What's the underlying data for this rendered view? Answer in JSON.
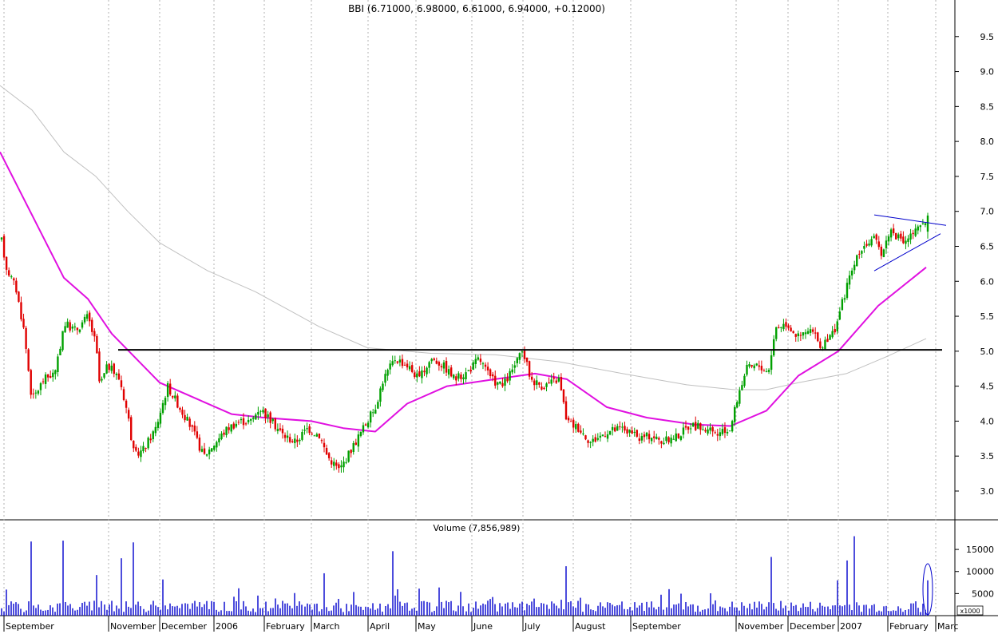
{
  "colors": {
    "background": "#ffffff",
    "up_candle": "#00a000",
    "down_candle": "#e00000",
    "ma_short": "#e010e0",
    "ma_long": "#c0c0c0",
    "volume": "#0000cc",
    "support_line": "#000000",
    "trendline": "#0000cc",
    "grid": "#b0b0b0"
  },
  "chart_data": [
    {
      "type": "candlestick",
      "title": "BBI (6.71000, 6.98000, 6.61000, 6.94000, +0.12000)",
      "ylim": [
        2.6,
        10.0
      ],
      "y_ticks": [
        3.0,
        3.5,
        4.0,
        4.5,
        5.0,
        5.5,
        6.0,
        6.5,
        7.0,
        7.5,
        8.0,
        8.5,
        9.0,
        9.5
      ],
      "x_month_labels": [
        "September",
        "November",
        "December",
        "2006",
        "February",
        "March",
        "April",
        "May",
        "June",
        "July",
        "August",
        "September",
        "November",
        "December",
        "2007",
        "February",
        "Marc"
      ],
      "grid": "vertical dotted at month boundaries",
      "last_ohlc": {
        "open": 6.71,
        "high": 6.98,
        "low": 6.61,
        "close": 6.94,
        "change": 0.12
      },
      "price_path": [
        [
          0,
          6.7
        ],
        [
          8,
          6.2
        ],
        [
          20,
          5.9
        ],
        [
          30,
          5.3
        ],
        [
          40,
          4.3
        ],
        [
          55,
          4.6
        ],
        [
          70,
          4.7
        ],
        [
          80,
          5.4
        ],
        [
          95,
          5.3
        ],
        [
          110,
          5.5
        ],
        [
          120,
          5.1
        ],
        [
          125,
          4.5
        ],
        [
          135,
          4.8
        ],
        [
          150,
          4.6
        ],
        [
          160,
          4.1
        ],
        [
          168,
          3.5
        ],
        [
          180,
          3.6
        ],
        [
          195,
          3.9
        ],
        [
          210,
          4.5
        ],
        [
          225,
          4.2
        ],
        [
          240,
          3.9
        ],
        [
          255,
          3.5
        ],
        [
          270,
          3.7
        ],
        [
          285,
          3.9
        ],
        [
          300,
          4.0
        ],
        [
          315,
          4.0
        ],
        [
          325,
          4.2
        ],
        [
          340,
          4.0
        ],
        [
          355,
          3.8
        ],
        [
          370,
          3.7
        ],
        [
          385,
          3.9
        ],
        [
          400,
          3.8
        ],
        [
          410,
          3.5
        ],
        [
          425,
          3.3
        ],
        [
          440,
          3.6
        ],
        [
          455,
          3.9
        ],
        [
          470,
          4.2
        ],
        [
          480,
          4.6
        ],
        [
          495,
          4.9
        ],
        [
          510,
          4.8
        ],
        [
          525,
          4.6
        ],
        [
          540,
          4.9
        ],
        [
          555,
          4.8
        ],
        [
          570,
          4.6
        ],
        [
          585,
          4.7
        ],
        [
          600,
          4.9
        ],
        [
          615,
          4.6
        ],
        [
          630,
          4.5
        ],
        [
          645,
          4.8
        ],
        [
          655,
          5.0
        ],
        [
          665,
          4.6
        ],
        [
          680,
          4.5
        ],
        [
          700,
          4.6
        ],
        [
          710,
          4.0
        ],
        [
          725,
          3.9
        ],
        [
          740,
          3.7
        ],
        [
          760,
          3.85
        ],
        [
          780,
          3.9
        ],
        [
          800,
          3.75
        ],
        [
          815,
          3.8
        ],
        [
          830,
          3.7
        ],
        [
          850,
          3.8
        ],
        [
          865,
          3.95
        ],
        [
          880,
          3.9
        ],
        [
          900,
          3.8
        ],
        [
          915,
          3.9
        ],
        [
          925,
          4.4
        ],
        [
          935,
          4.75
        ],
        [
          950,
          4.8
        ],
        [
          962,
          4.7
        ],
        [
          972,
          5.35
        ],
        [
          985,
          5.4
        ],
        [
          1000,
          5.2
        ],
        [
          1015,
          5.3
        ],
        [
          1030,
          5.05
        ],
        [
          1045,
          5.3
        ],
        [
          1055,
          5.7
        ],
        [
          1065,
          6.1
        ],
        [
          1080,
          6.5
        ],
        [
          1095,
          6.6
        ],
        [
          1105,
          6.4
        ],
        [
          1115,
          6.75
        ],
        [
          1130,
          6.55
        ],
        [
          1145,
          6.7
        ],
        [
          1158,
          6.82
        ],
        [
          1162,
          6.94
        ]
      ],
      "ma_short_path": [
        [
          0,
          7.85
        ],
        [
          40,
          6.95
        ],
        [
          80,
          6.05
        ],
        [
          110,
          5.75
        ],
        [
          140,
          5.25
        ],
        [
          200,
          4.55
        ],
        [
          250,
          4.3
        ],
        [
          290,
          4.1
        ],
        [
          330,
          4.05
        ],
        [
          390,
          4.0
        ],
        [
          430,
          3.9
        ],
        [
          470,
          3.85
        ],
        [
          510,
          4.25
        ],
        [
          560,
          4.5
        ],
        [
          620,
          4.6
        ],
        [
          670,
          4.68
        ],
        [
          710,
          4.6
        ],
        [
          760,
          4.2
        ],
        [
          810,
          4.05
        ],
        [
          870,
          3.95
        ],
        [
          915,
          3.93
        ],
        [
          960,
          4.15
        ],
        [
          1000,
          4.65
        ],
        [
          1050,
          5.0
        ],
        [
          1100,
          5.65
        ],
        [
          1160,
          6.2
        ]
      ],
      "ma_long_path": [
        [
          0,
          8.8
        ],
        [
          40,
          8.45
        ],
        [
          80,
          7.85
        ],
        [
          120,
          7.5
        ],
        [
          160,
          7.0
        ],
        [
          200,
          6.55
        ],
        [
          260,
          6.15
        ],
        [
          320,
          5.85
        ],
        [
          400,
          5.35
        ],
        [
          460,
          5.05
        ],
        [
          540,
          4.97
        ],
        [
          620,
          4.95
        ],
        [
          700,
          4.85
        ],
        [
          780,
          4.68
        ],
        [
          860,
          4.52
        ],
        [
          920,
          4.45
        ],
        [
          960,
          4.45
        ],
        [
          1000,
          4.55
        ],
        [
          1060,
          4.68
        ],
        [
          1110,
          4.92
        ],
        [
          1160,
          5.18
        ]
      ],
      "support_level": 5.02,
      "triangle_upper": [
        [
          1095,
          6.95
        ],
        [
          1185,
          6.8
        ]
      ],
      "triangle_lower": [
        [
          1095,
          6.15
        ],
        [
          1178,
          6.68
        ]
      ],
      "candle_count": 380
    },
    {
      "type": "bar",
      "title": "Volume (7,856,989)",
      "ylim": [
        0,
        19000
      ],
      "y_ticks": [
        5000,
        10000,
        15000
      ],
      "units_note": "x1000",
      "spikes": [
        [
          38,
          16800
        ],
        [
          80,
          17000
        ],
        [
          122,
          9200
        ],
        [
          152,
          13000
        ],
        [
          168,
          16600
        ],
        [
          204,
          8200
        ],
        [
          300,
          6200
        ],
        [
          406,
          9600
        ],
        [
          493,
          14600
        ],
        [
          708,
          11200
        ],
        [
          838,
          6000
        ],
        [
          966,
          13300
        ],
        [
          1071,
          18000
        ],
        [
          1048,
          8000
        ],
        [
          1060,
          12500
        ],
        [
          1161,
          8000
        ]
      ],
      "baseline": [
        0,
        7000
      ],
      "highlight_ellipse_center_x": 1162
    }
  ]
}
